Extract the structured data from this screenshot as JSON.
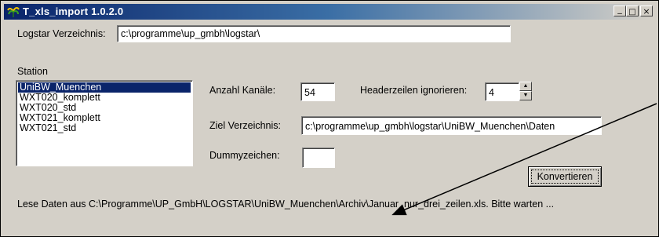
{
  "window": {
    "title": "T_xls_import   1.0.2.0",
    "minimize_label": "_",
    "maximize_label": "□",
    "close_label": "×"
  },
  "logstar": {
    "label": "Logstar Verzeichnis:",
    "value": "c:\\programme\\up_gmbh\\logstar\\"
  },
  "station": {
    "label": "Station",
    "items": [
      "UniBW_Muenchen",
      "WXT020_komplett",
      "WXT020_std",
      "WXT021_komplett",
      "WXT021_std"
    ],
    "selected_index": 0
  },
  "channels": {
    "label": "Anzahl Kanäle:",
    "value": "54"
  },
  "header_rows": {
    "label": "Headerzeilen ignorieren:",
    "value": "4"
  },
  "target_dir": {
    "label": "Ziel Verzeichnis:",
    "value": "c:\\programme\\up_gmbh\\logstar\\UniBW_Muenchen\\Daten"
  },
  "dummy": {
    "label": "Dummyzeichen:",
    "value": ""
  },
  "convert_button": {
    "label": "Konvertieren"
  },
  "status": {
    "text": "Lese Daten aus C:\\Programme\\UP_GmbH\\LOGSTAR\\UniBW_Muenchen\\Archiv\\Januar_nur_drei_zeilen.xls.  Bitte warten ..."
  }
}
